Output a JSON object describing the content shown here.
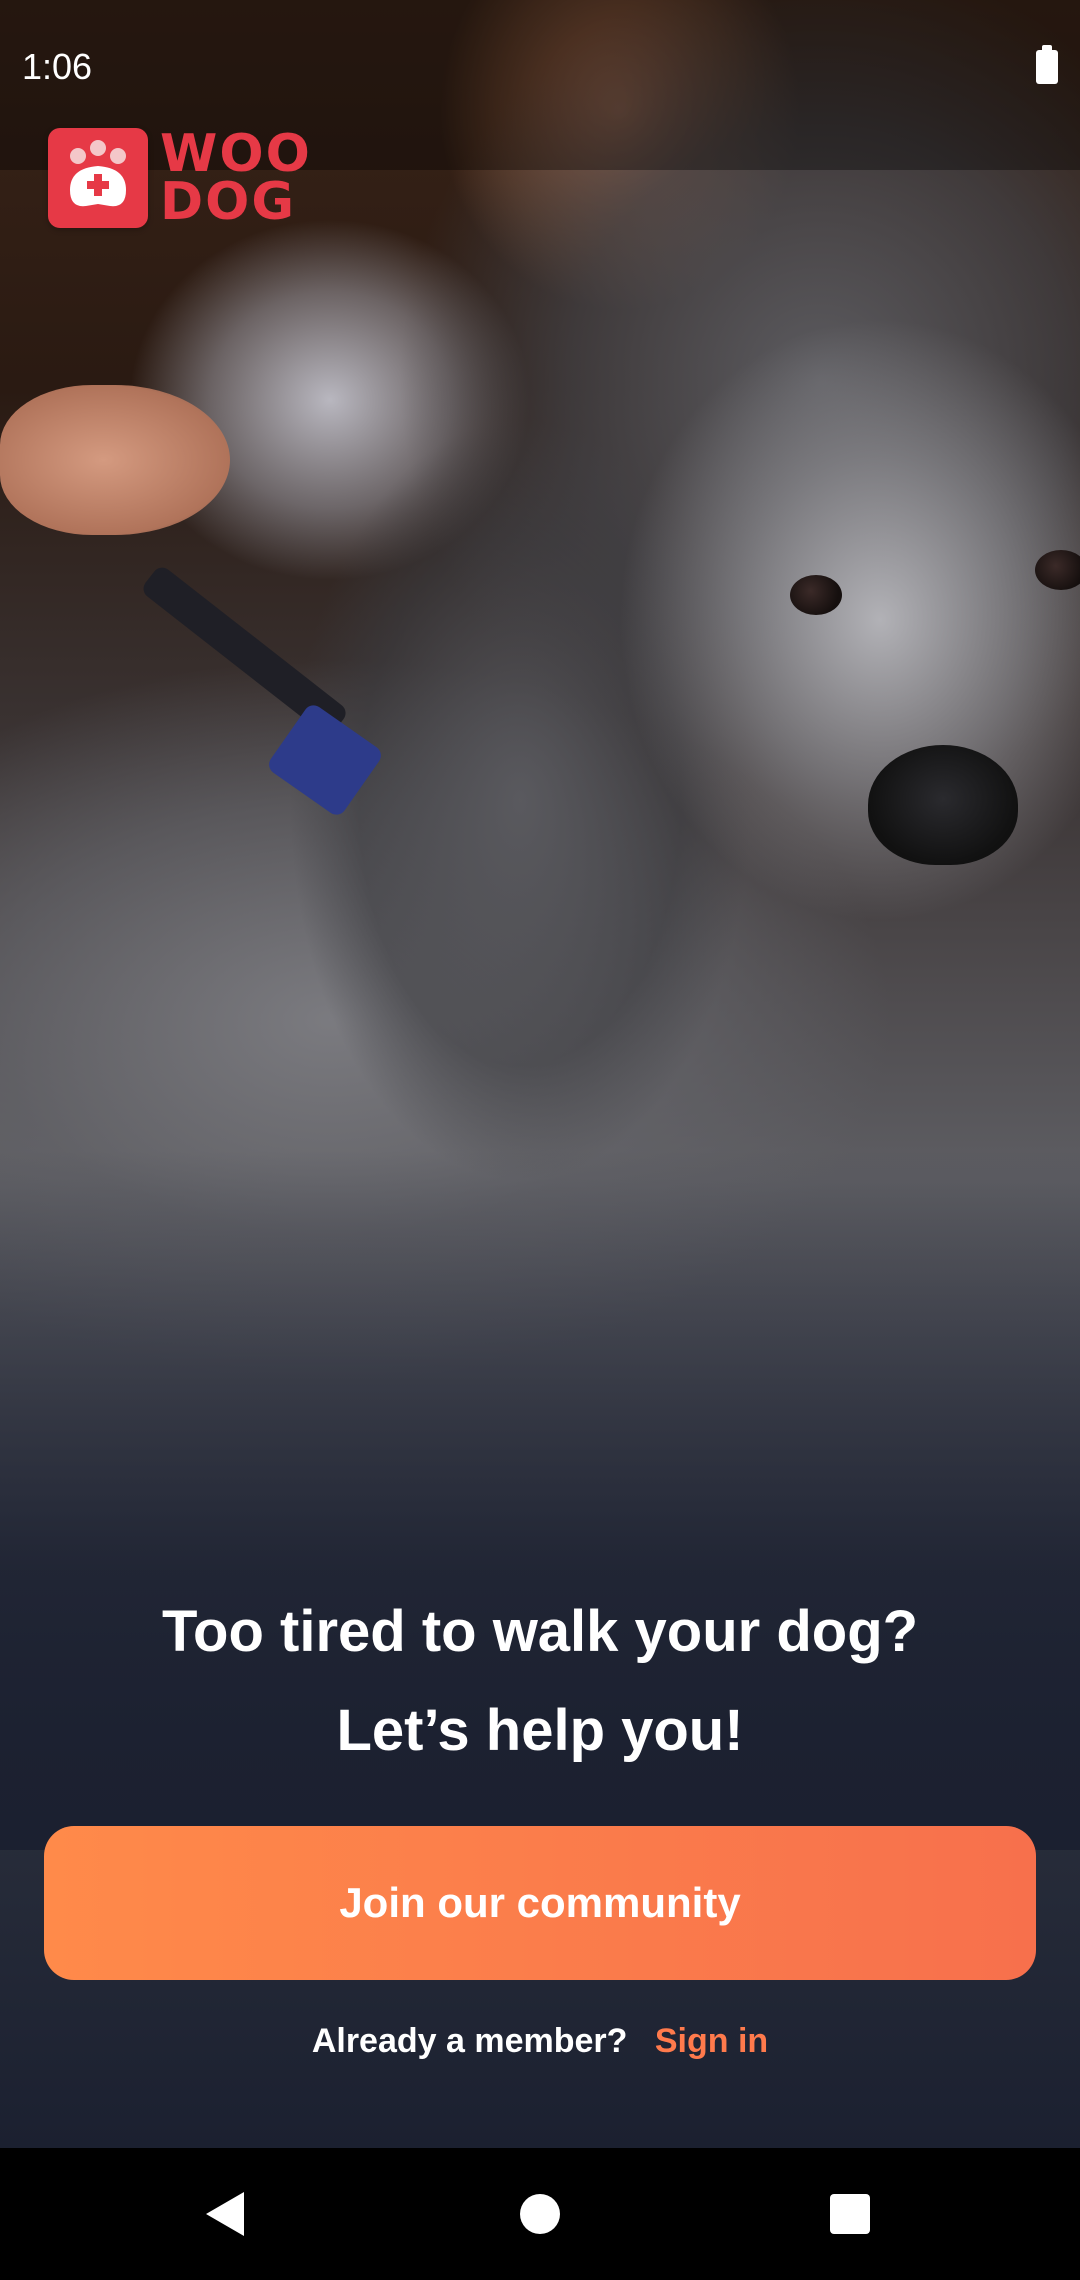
{
  "status_bar": {
    "time": "1:06",
    "battery_icon": "battery-icon"
  },
  "brand": {
    "name_line1": "WOO",
    "name_line2": "DOG",
    "color": "#e63946",
    "logo_icon": "paw-medical-icon"
  },
  "hero": {
    "image": "poodle-grooming-photo"
  },
  "headline": {
    "line1": "Too tired to walk your dog?",
    "line2": "Let’s help you!"
  },
  "cta": {
    "label": "Join our community",
    "color_start": "#ff8a4a",
    "color_end": "#f7704c"
  },
  "signin": {
    "prompt": "Already a member?",
    "link": "Sign in",
    "link_color": "#ff7a4c"
  },
  "navigation": {
    "back": "back-icon",
    "home": "home-icon",
    "recents": "recents-icon"
  }
}
